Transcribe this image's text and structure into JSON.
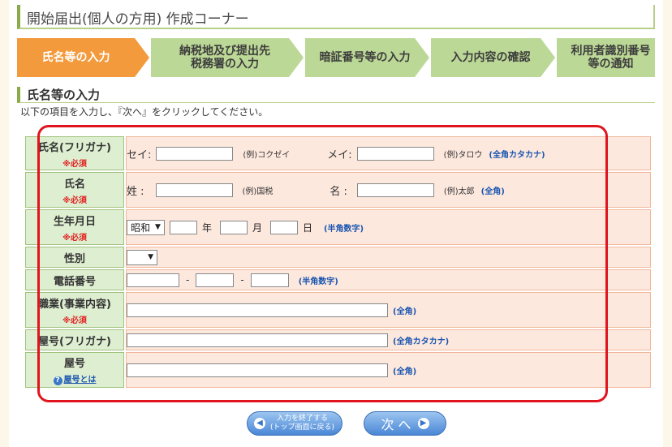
{
  "page_title": "開始届出(個人の方用) 作成コーナー",
  "steps": [
    {
      "label": "氏名等の入力",
      "active": true
    },
    {
      "label": "納税地及び提出先\n税務署の入力"
    },
    {
      "label": "暗証番号等の入力"
    },
    {
      "label": "入力内容の確認"
    },
    {
      "label": "利用者識別番号\n等の通知"
    }
  ],
  "section": {
    "heading": "氏名等の入力",
    "instruction": "以下の項目を入力し、『次へ』をクリックしてください。"
  },
  "form": {
    "required_mark": "※必須",
    "name_kana": {
      "label": "氏名(フリガナ)",
      "sei_label": "セイ:",
      "sei_value": "",
      "sei_example": "(例)コクゼイ",
      "mei_label": "メイ:",
      "mei_value": "",
      "mei_example": "(例)タロウ",
      "hint": "(全角カタカナ)"
    },
    "name": {
      "label": "氏名",
      "sei_label": "姓 :",
      "sei_value": "",
      "sei_example": "(例)国税",
      "mei_label": "名 :",
      "mei_value": "",
      "mei_example": "(例)太郎",
      "hint": "(全角)"
    },
    "birth": {
      "label": "生年月日",
      "era_selected": "昭和",
      "year_unit": "年",
      "month_unit": "月",
      "day_unit": "日",
      "hint": "(半角数字)"
    },
    "gender": {
      "label": "性別",
      "selected": ""
    },
    "phone": {
      "label": "電話番号",
      "separator": "-",
      "hint": "(半角数字)"
    },
    "occupation": {
      "label": "職業(事業内容)",
      "hint": "(全角)"
    },
    "yago_kana": {
      "label": "屋号(フリガナ)",
      "hint": "(全角カタカナ)"
    },
    "yago": {
      "label": "屋号",
      "help_link": "屋号とは",
      "hint": "(全角)"
    }
  },
  "buttons": {
    "back_line1": "入力を終了する",
    "back_line2": "(トップ画面に戻る)",
    "next": "次 へ"
  },
  "colors": {
    "active_step": "#f39a3c",
    "inactive_step": "#bcd896",
    "highlight_border": "#e0141e",
    "hint_text": "#1a55b0",
    "required_text": "#e02020"
  }
}
